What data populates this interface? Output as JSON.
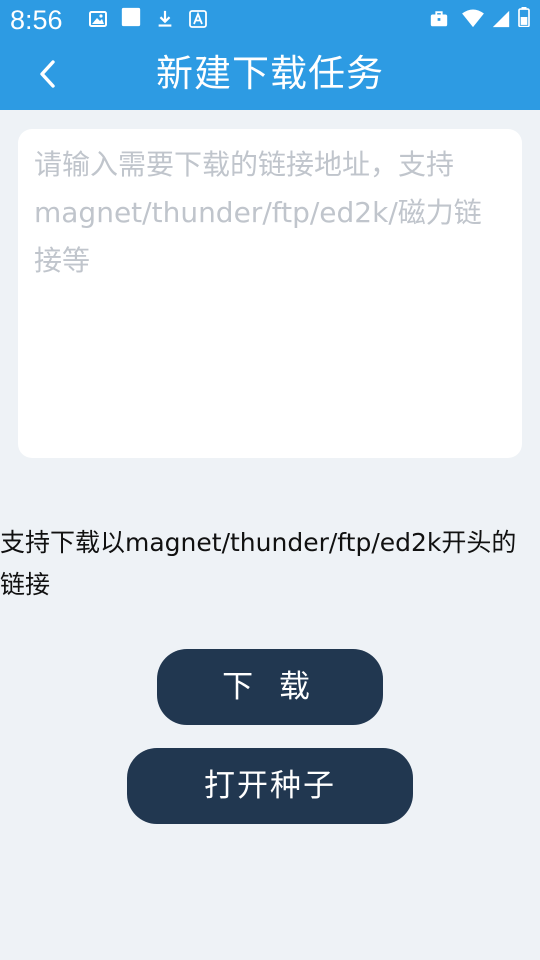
{
  "status_bar": {
    "time": "8:56",
    "left_icons": [
      "image-icon",
      "app-square-icon",
      "download-icon",
      "font-a-icon"
    ],
    "right_icons": [
      "briefcase-icon",
      "wifi-icon",
      "signal-icon",
      "battery-icon"
    ]
  },
  "app_bar": {
    "title": "新建下载任务",
    "background_color": "#2d9be3"
  },
  "url_input": {
    "value": "",
    "placeholder": "请输入需要下载的链接地址，支持magnet/thunder/ftp/ed2k/磁力链接等"
  },
  "hint": {
    "text": "支持下载以magnet/thunder/ftp/ed2k开头的链接"
  },
  "buttons": {
    "download_label": "下 载",
    "open_torrent_label": "打开种子",
    "color": "#213750"
  }
}
